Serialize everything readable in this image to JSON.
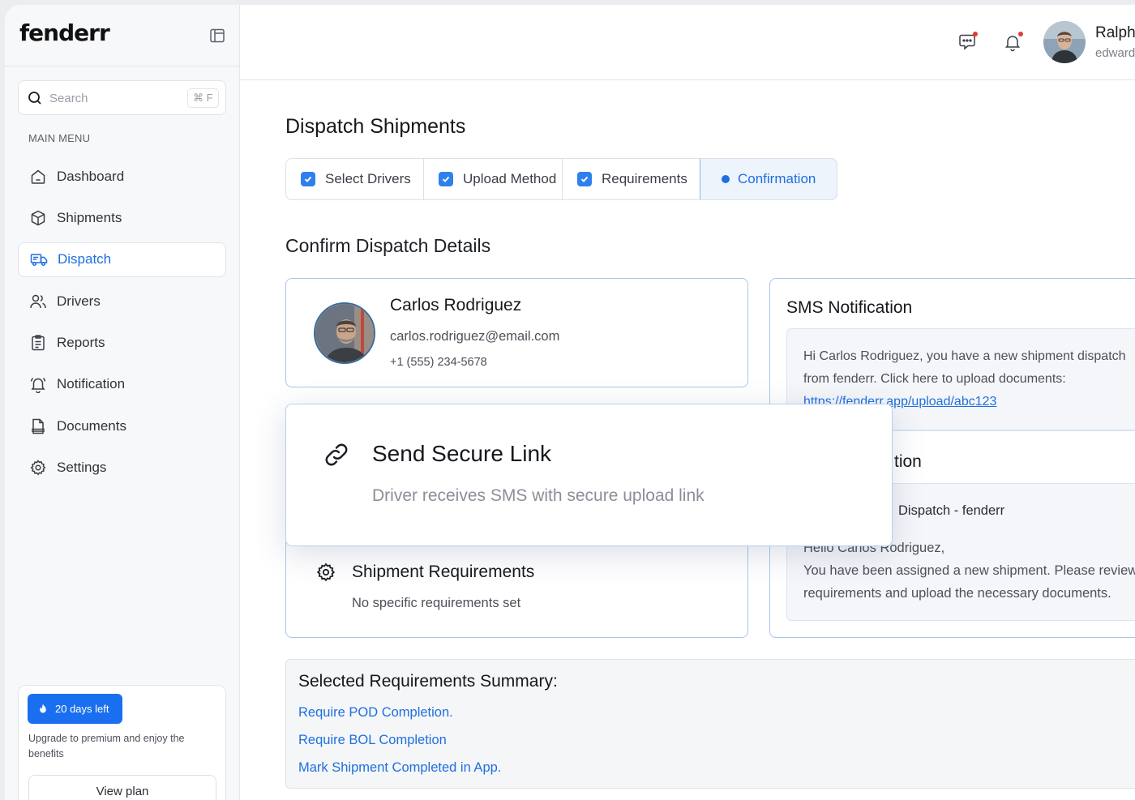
{
  "brand": "fenderr",
  "search": {
    "placeholder": "Search",
    "shortcut": "⌘ F"
  },
  "sidebar": {
    "menu_label": "MAIN MENU",
    "items": [
      {
        "label": "Dashboard",
        "icon": "home-icon"
      },
      {
        "label": "Shipments",
        "icon": "box-icon"
      },
      {
        "label": "Dispatch",
        "icon": "truck-icon",
        "active": true
      },
      {
        "label": "Drivers",
        "icon": "users-icon"
      },
      {
        "label": "Reports",
        "icon": "clipboard-icon"
      },
      {
        "label": "Notification",
        "icon": "bell-icon"
      },
      {
        "label": "Documents",
        "icon": "document-icon"
      },
      {
        "label": "Settings",
        "icon": "gear-icon"
      }
    ],
    "promo": {
      "badge": "20 days left",
      "text": "Upgrade to premium and enjoy the benefits",
      "button": "View plan"
    }
  },
  "header": {
    "user_name": "Ralph",
    "user_email": "edward"
  },
  "page": {
    "title": "Dispatch Shipments",
    "steps": [
      {
        "label": "Select Drivers",
        "state": "done"
      },
      {
        "label": "Upload Method",
        "state": "done"
      },
      {
        "label": "Requirements",
        "state": "done"
      },
      {
        "label": "Confirmation",
        "state": "current"
      }
    ],
    "section_title": "Confirm Dispatch Details"
  },
  "driver": {
    "name": "Carlos Rodriguez",
    "email": "carlos.rodriguez@email.com",
    "phone": "+1 (555) 234-5678"
  },
  "requirements_card": {
    "title": "Shipment Requirements",
    "subtitle": "No specific requirements set"
  },
  "sms": {
    "title": "SMS Notification",
    "message": "Hi Carlos Rodriguez, you have a new shipment dispatch from fenderr. Click here to upload documents:",
    "link": "https://fenderr.app/upload/abc123"
  },
  "email": {
    "title_visible": "tion",
    "subject_visible": "Dispatch - fenderr",
    "greeting": "Hello Carlos Rodriguez,",
    "body": "You have been assigned a new shipment. Please review requirements and upload the necessary documents."
  },
  "popover": {
    "title": "Send Secure Link",
    "subtitle": "Driver receives SMS with secure upload link"
  },
  "summary": {
    "title": "Selected Requirements Summary:",
    "items": [
      "Require POD Completion.",
      "Require BOL Completion",
      "Mark Shipment Completed in App."
    ]
  },
  "colors": {
    "accent": "#1f6fe0",
    "check": "#2f80ed",
    "badge": "#1a6ff0",
    "notification_dot": "#e53935"
  }
}
